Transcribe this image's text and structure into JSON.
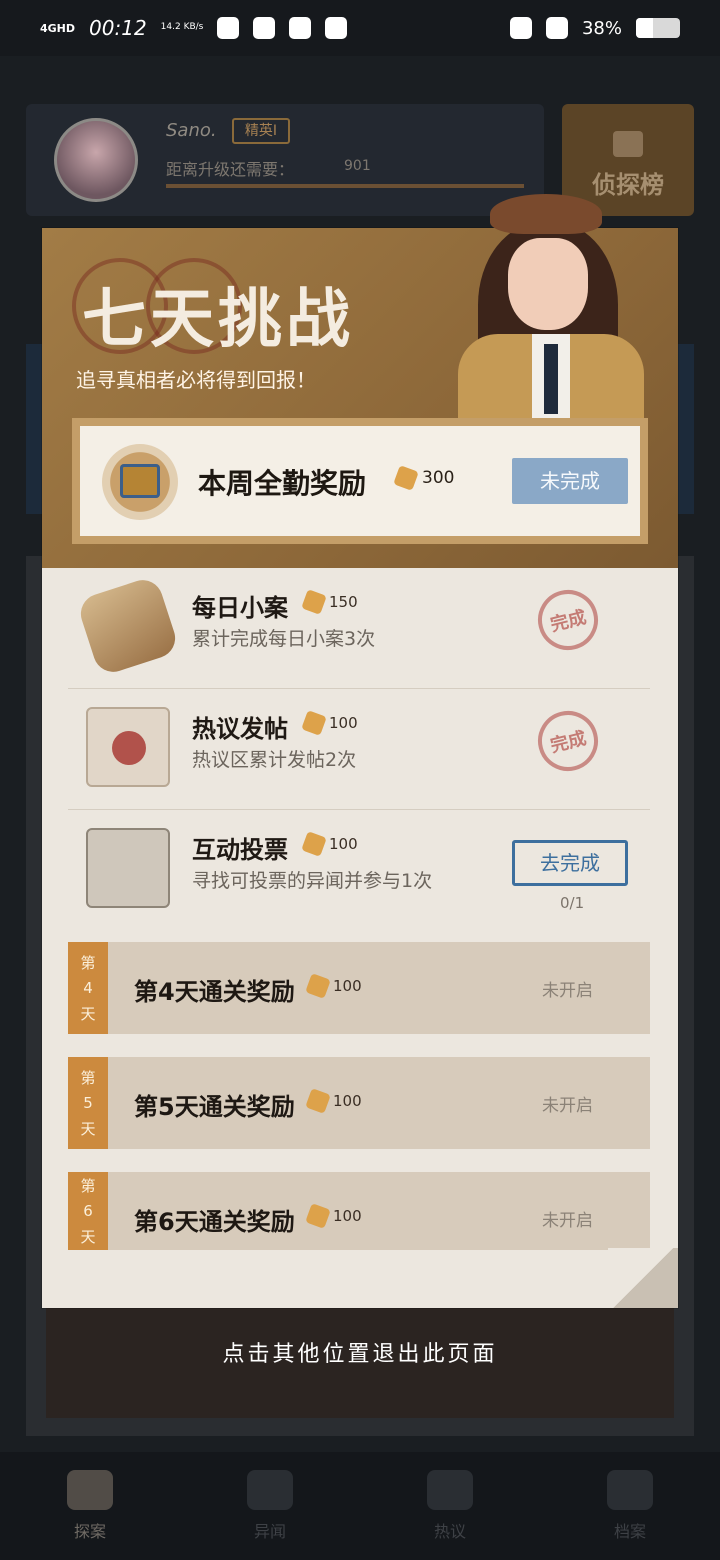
{
  "status_bar": {
    "network": "4GHD",
    "time": "00:12",
    "speed": "14.2 KB/s",
    "battery": "38%"
  },
  "profile": {
    "username": "Sano.",
    "rank": "精英I",
    "upgrade_text": "距离升级还需要：",
    "upgrade_value": "901"
  },
  "leaderboard_label": "侦探榜",
  "modal": {
    "title": "七天挑战",
    "subtitle": "追寻真相者必将得到回报！",
    "weekly": {
      "title": "本周全勤奖励",
      "reward": "300",
      "button": "未完成"
    },
    "tasks": [
      {
        "title": "每日小案",
        "reward": "150",
        "desc": "累计完成每日小案3次",
        "status": "完成"
      },
      {
        "title": "热议发帖",
        "reward": "100",
        "desc": "热议区累计发帖2次",
        "status": "完成"
      },
      {
        "title": "互动投票",
        "reward": "100",
        "desc": "寻找可投票的异闻并参与1次",
        "button": "去完成",
        "progress": "0/1"
      }
    ],
    "days": [
      {
        "tag": [
          "第",
          "4",
          "天"
        ],
        "title": "第4天通关奖励",
        "reward": "100",
        "status": "未开启"
      },
      {
        "tag": [
          "第",
          "5",
          "天"
        ],
        "title": "第5天通关奖励",
        "reward": "100",
        "status": "未开启"
      },
      {
        "tag": [
          "第",
          "6",
          "天"
        ],
        "title": "第6天通关奖励",
        "reward": "100",
        "status": "未开启"
      }
    ]
  },
  "exit_hint": "点击其他位置退出此页面",
  "nav": [
    {
      "label": "探案",
      "icon": "pipe-icon"
    },
    {
      "label": "异闻",
      "icon": "video-icon"
    },
    {
      "label": "热议",
      "icon": "chat-icon"
    },
    {
      "label": "档案",
      "icon": "archive-icon"
    }
  ]
}
